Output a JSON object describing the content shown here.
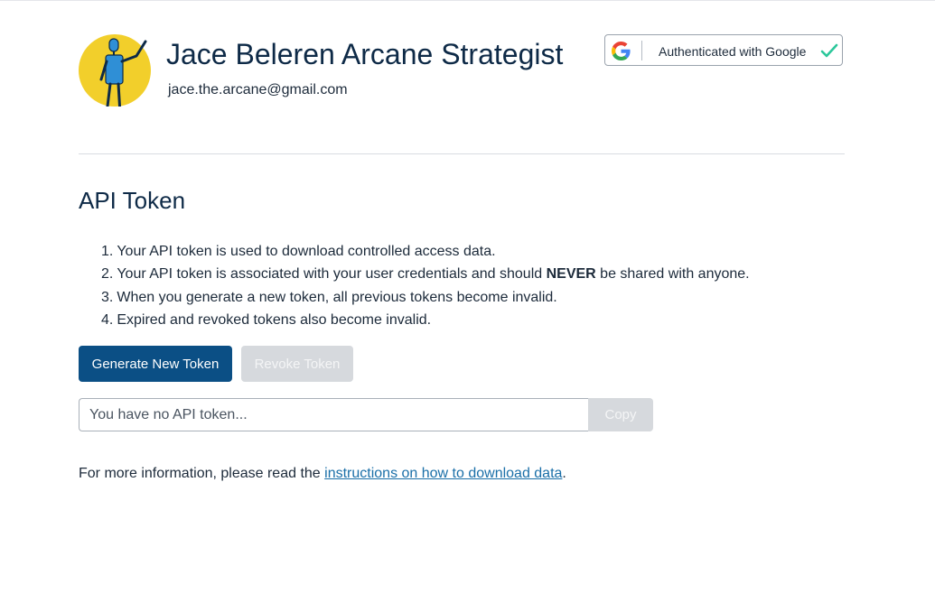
{
  "profile": {
    "name": "Jace Beleren Arcane Strategist",
    "email": "jace.the.arcane@gmail.com",
    "avatar_icon": "person-waving-avatar-icon"
  },
  "auth": {
    "label": "Authenticated with Google",
    "provider_icon": "google-icon",
    "status_icon": "checkmark-icon",
    "status_color": "#2cc79b"
  },
  "api_token": {
    "title": "API Token",
    "items": [
      {
        "num": "1.",
        "text": "Your API token is used to download controlled access data."
      },
      {
        "num": "2.",
        "text_before": "Your API token is associated with your user credentials and should ",
        "emphasis": "NEVER",
        "text_after": " be shared with anyone."
      },
      {
        "num": "3.",
        "text": "When you generate a new token, all previous tokens become invalid."
      },
      {
        "num": "4.",
        "text": "Expired and revoked tokens also become invalid."
      }
    ],
    "generate_label": "Generate New Token",
    "revoke_label": "Revoke Token",
    "token_placeholder": "You have no API token...",
    "token_value": "",
    "copy_label": "Copy"
  },
  "footer": {
    "text": "For more information, please read the ",
    "link_text": "instructions on how to download data",
    "suffix": "."
  },
  "colors": {
    "primary": "#0b4f85",
    "heading": "#0e2a47",
    "disabled": "#d6d9dd",
    "link": "#1a6fa8",
    "avatar_bg": "#f2cf2b",
    "avatar_figure": "#2f8fd6"
  }
}
